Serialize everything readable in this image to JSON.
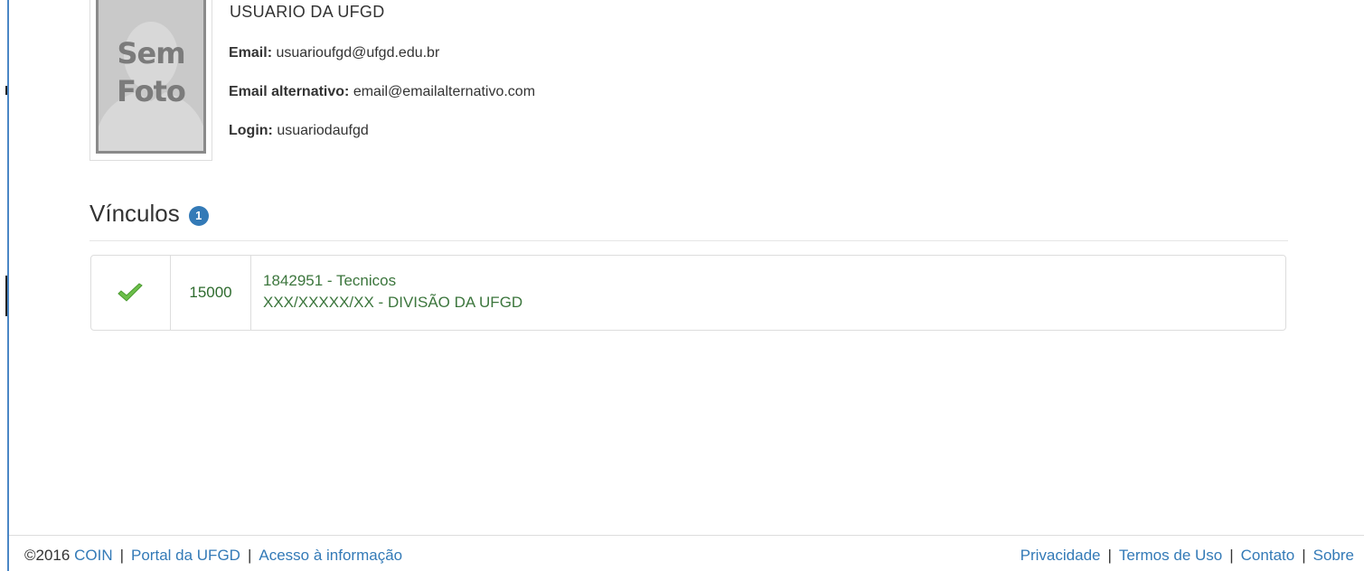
{
  "profile": {
    "photo_text_line1": "Sem",
    "photo_text_line2": "Foto",
    "name": "USUARIO DA UFGD",
    "email_label": "Email:",
    "email_value": "usuarioufgd@ufgd.edu.br",
    "alt_email_label": "Email alternativo:",
    "alt_email_value": "email@emailalternativo.com",
    "login_label": "Login:",
    "login_value": "usuariodaufgd"
  },
  "vinculos": {
    "title": "Vínculos",
    "count": "1",
    "items": [
      {
        "status_icon": "check-icon",
        "code": "15000",
        "line1": "1842951 - Tecnicos",
        "line2": "XXX/XXXXX/XX - DIVISÃO DA UFGD"
      }
    ]
  },
  "footer": {
    "copyright": "©2016",
    "coin": "COIN",
    "portal": "Portal da UFGD",
    "acesso": "Acesso à informação",
    "privacidade": "Privacidade",
    "termos": "Termos de Uso",
    "contato": "Contato",
    "sobre": "Sobre",
    "separator": "|"
  },
  "colors": {
    "link": "#337ab7",
    "success_text": "#3c763d",
    "badge": "#337ab7",
    "check": "#5cb85c"
  }
}
